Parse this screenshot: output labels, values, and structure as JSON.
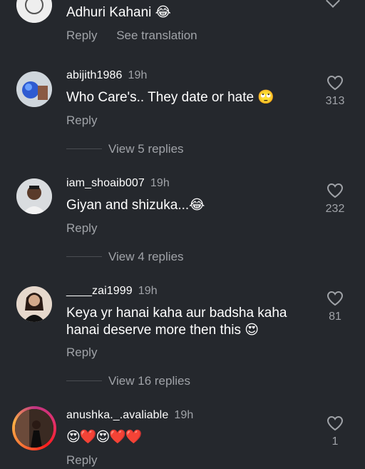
{
  "comments": [
    {
      "username": "",
      "time": "",
      "text": "Adhuri Kahani 😂",
      "reply": "Reply",
      "translate": "See translation",
      "likes": ""
    },
    {
      "username": "abijith1986",
      "time": "19h",
      "text": "Who Care's.. They date or hate 🙄",
      "reply": "Reply",
      "likes": "313",
      "view_replies": "View 5 replies"
    },
    {
      "username": "iam_shoaib007",
      "time": "19h",
      "text": "Giyan and shizuka...😂",
      "reply": "Reply",
      "likes": "232",
      "view_replies": "View 4 replies"
    },
    {
      "username": "____zai1999",
      "time": "19h",
      "text": "Keya yr hanai kaha aur badsha kaha hanai deserve more then this 😍",
      "reply": "Reply",
      "likes": "81",
      "view_replies": "View 16 replies"
    },
    {
      "username": "anushka._.avaliable",
      "time": "19h",
      "text": "😍❤️😍❤️❤️",
      "reply": "Reply",
      "likes": "1"
    }
  ],
  "colors": {
    "background": "#25282d",
    "secondary_text": "#a0a3a8",
    "primary_text": "#ffffff"
  },
  "icons": [
    "heart-outline-icon",
    "chevron-down-icon"
  ]
}
